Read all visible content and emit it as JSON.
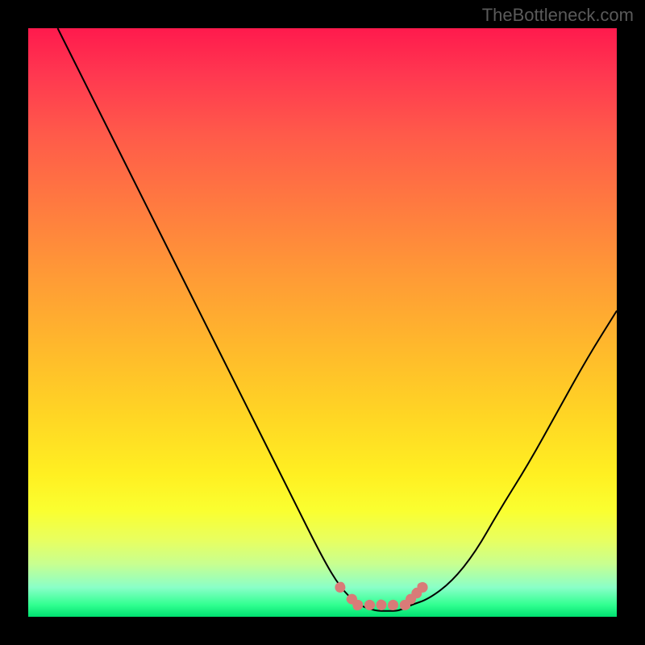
{
  "watermark": "TheBottleneck.com",
  "chart_data": {
    "type": "line",
    "title": "",
    "xlabel": "",
    "ylabel": "",
    "xlim": [
      0,
      100
    ],
    "ylim": [
      0,
      100
    ],
    "series": [
      {
        "name": "bottleneck-curve",
        "x": [
          5,
          10,
          15,
          20,
          25,
          30,
          35,
          40,
          45,
          50,
          53,
          56,
          59,
          61,
          63,
          65,
          68,
          72,
          76,
          80,
          85,
          90,
          95,
          100
        ],
        "y": [
          100,
          90,
          80,
          70,
          60,
          50,
          40,
          30,
          20,
          10,
          5,
          2,
          1,
          1,
          1,
          2,
          3,
          6,
          11,
          18,
          26,
          35,
          44,
          52
        ]
      }
    ],
    "markers": {
      "name": "highlight-range",
      "color": "#d97b78",
      "points": [
        {
          "x": 53,
          "y": 5
        },
        {
          "x": 55,
          "y": 3
        },
        {
          "x": 56,
          "y": 2
        },
        {
          "x": 58,
          "y": 2
        },
        {
          "x": 60,
          "y": 2
        },
        {
          "x": 62,
          "y": 2
        },
        {
          "x": 64,
          "y": 2
        },
        {
          "x": 65,
          "y": 3
        },
        {
          "x": 66,
          "y": 4
        },
        {
          "x": 67,
          "y": 5
        }
      ]
    },
    "gradient_stops": [
      {
        "pos": 0,
        "color": "#ff1a4d"
      },
      {
        "pos": 50,
        "color": "#ffd030"
      },
      {
        "pos": 85,
        "color": "#f8ff40"
      },
      {
        "pos": 100,
        "color": "#00e070"
      }
    ]
  }
}
